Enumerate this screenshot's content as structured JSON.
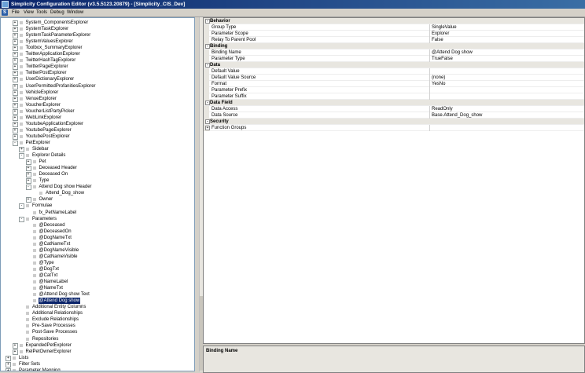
{
  "window": {
    "title": "Simplicity Configuration Editor (v3.5.5123.20879) - [Simplicity_CIS_Dev]"
  },
  "menu": [
    "File",
    "View",
    "Tools",
    "Debug",
    "Window"
  ],
  "tree": [
    {
      "label": "System_ComponentsExplorer",
      "level": 0,
      "exp": "+",
      "icon": "folder"
    },
    {
      "label": "SystemTaskExplorer",
      "level": 0,
      "exp": "+",
      "icon": "folder"
    },
    {
      "label": "SystemTaskParameterExplorer",
      "level": 0,
      "exp": "+",
      "icon": "folder"
    },
    {
      "label": "SystemValuesExplorer",
      "level": 0,
      "exp": "+",
      "icon": "folder"
    },
    {
      "label": "Toolbox_SummaryExplorer",
      "level": 0,
      "exp": "+",
      "icon": "folder"
    },
    {
      "label": "TwitterApplicationExplorer",
      "level": 0,
      "exp": "+",
      "icon": "folder"
    },
    {
      "label": "TwitterHashTagExplorer",
      "level": 0,
      "exp": "+",
      "icon": "folder"
    },
    {
      "label": "TwitterPageExplorer",
      "level": 0,
      "exp": "+",
      "icon": "folder"
    },
    {
      "label": "TwitterPostExplorer",
      "level": 0,
      "exp": "+",
      "icon": "folder"
    },
    {
      "label": "UserDictionaryExplorer",
      "level": 0,
      "exp": "+",
      "icon": "folder"
    },
    {
      "label": "UserPermittedProfanitiesExplorer",
      "level": 0,
      "exp": "+",
      "icon": "folder"
    },
    {
      "label": "VehicleExplorer",
      "level": 0,
      "exp": "+",
      "icon": "folder"
    },
    {
      "label": "VenueExplorer",
      "level": 0,
      "exp": "+",
      "icon": "folder"
    },
    {
      "label": "VoucherExplorer",
      "level": 0,
      "exp": "+",
      "icon": "folder"
    },
    {
      "label": "VoucherListPartyPicker",
      "level": 0,
      "exp": "+",
      "icon": "folder"
    },
    {
      "label": "WebLinkExplorer",
      "level": 0,
      "exp": "+",
      "icon": "folder"
    },
    {
      "label": "YoutubeApplicationExplorer",
      "level": 0,
      "exp": "+",
      "icon": "folder"
    },
    {
      "label": "YoutubePageExplorer",
      "level": 0,
      "exp": "+",
      "icon": "folder"
    },
    {
      "label": "YoutubePostExplorer",
      "level": 0,
      "exp": "+",
      "icon": "folder"
    },
    {
      "label": "PetExplorer",
      "level": 0,
      "exp": "-",
      "icon": "folder"
    },
    {
      "label": "Sidebar",
      "level": 1,
      "exp": "+",
      "icon": "folder"
    },
    {
      "label": "Explorer Details",
      "level": 1,
      "exp": "-",
      "icon": "folder"
    },
    {
      "label": "Pet",
      "level": 2,
      "exp": "+",
      "icon": "item"
    },
    {
      "label": "Deceased Header",
      "level": 2,
      "exp": "+",
      "icon": "item"
    },
    {
      "label": "Deceased On",
      "level": 2,
      "exp": "+",
      "icon": "item"
    },
    {
      "label": "Type",
      "level": 2,
      "exp": "+",
      "icon": "item"
    },
    {
      "label": "Attend Dog show Header",
      "level": 2,
      "exp": "-",
      "icon": "item"
    },
    {
      "label": "Attend_Dog_show",
      "level": 3,
      "exp": "",
      "icon": "item"
    },
    {
      "label": "Owner",
      "level": 2,
      "exp": "+",
      "icon": "item"
    },
    {
      "label": "Formulae",
      "level": 1,
      "exp": "-",
      "icon": "folder"
    },
    {
      "label": "fx_PetNameLabel",
      "level": 2,
      "exp": "",
      "icon": "item"
    },
    {
      "label": "Parameters",
      "level": 1,
      "exp": "-",
      "icon": "folder"
    },
    {
      "label": "@Deceased",
      "level": 2,
      "exp": "",
      "icon": "item"
    },
    {
      "label": "@DeceasedOn",
      "level": 2,
      "exp": "",
      "icon": "item"
    },
    {
      "label": "@DogNameTxt",
      "level": 2,
      "exp": "",
      "icon": "item"
    },
    {
      "label": "@CatNameTxt",
      "level": 2,
      "exp": "",
      "icon": "item"
    },
    {
      "label": "@DogNameVisible",
      "level": 2,
      "exp": "",
      "icon": "item"
    },
    {
      "label": "@CatNameVisible",
      "level": 2,
      "exp": "",
      "icon": "item"
    },
    {
      "label": "@Type",
      "level": 2,
      "exp": "",
      "icon": "item"
    },
    {
      "label": "@DogTxt",
      "level": 2,
      "exp": "",
      "icon": "item"
    },
    {
      "label": "@CatTxt",
      "level": 2,
      "exp": "",
      "icon": "item"
    },
    {
      "label": "@NameLabel",
      "level": 2,
      "exp": "",
      "icon": "item"
    },
    {
      "label": "@NameTxt",
      "level": 2,
      "exp": "",
      "icon": "item"
    },
    {
      "label": "@Attend Dog show Text",
      "level": 2,
      "exp": "",
      "icon": "item"
    },
    {
      "label": "@Attend Dog show",
      "level": 2,
      "exp": "",
      "icon": "item",
      "selected": true
    },
    {
      "label": "Additional Entity Columns",
      "level": 1,
      "exp": "",
      "icon": "item"
    },
    {
      "label": "Additional Relationships",
      "level": 1,
      "exp": "",
      "icon": "item"
    },
    {
      "label": "Exclude Relationships",
      "level": 1,
      "exp": "",
      "icon": "item"
    },
    {
      "label": "Pre-Save Processes",
      "level": 1,
      "exp": "",
      "icon": "item"
    },
    {
      "label": "Post-Save Processes",
      "level": 1,
      "exp": "",
      "icon": "item"
    },
    {
      "label": "Repositories",
      "level": 1,
      "exp": "",
      "icon": "item"
    },
    {
      "label": "ExpandedPetExplorer",
      "level": 0,
      "exp": "+",
      "icon": "folder"
    },
    {
      "label": "RelPetOwnerExplorer",
      "level": 0,
      "exp": "+",
      "icon": "folder"
    },
    {
      "label": "Lists",
      "level": -1,
      "exp": "+",
      "icon": "folder"
    },
    {
      "label": "Filter Sets",
      "level": -1,
      "exp": "+",
      "icon": "folder"
    },
    {
      "label": "Parameter Mapping",
      "level": -1,
      "exp": "+",
      "icon": "folder"
    }
  ],
  "properties": [
    {
      "category": "Behavior",
      "rows": [
        {
          "name": "Group Type",
          "value": "SingleValue"
        },
        {
          "name": "Parameter Scope",
          "value": "Explorer"
        },
        {
          "name": "Relay To Parent Pool",
          "value": "False"
        }
      ]
    },
    {
      "category": "Binding",
      "rows": [
        {
          "name": "Binding Name",
          "value": "@Attend Dog show"
        },
        {
          "name": "Parameter Type",
          "value": "TrueFalse"
        }
      ]
    },
    {
      "category": "Data",
      "rows": [
        {
          "name": "Default Value",
          "value": ""
        },
        {
          "name": "Default Value Source",
          "value": "(none)"
        },
        {
          "name": "Format",
          "value": "YesNo"
        },
        {
          "name": "Parameter Prefix",
          "value": ""
        },
        {
          "name": "Parameter Suffix",
          "value": ""
        }
      ]
    },
    {
      "category": "Data Field",
      "rows": [
        {
          "name": "Data Access",
          "value": "ReadOnly"
        },
        {
          "name": "Data Source",
          "value": "Base.Attend_Dog_show"
        }
      ]
    },
    {
      "category": "Security",
      "rows": [
        {
          "name": "Function Groups",
          "value": "",
          "expandable": true
        }
      ]
    }
  ],
  "help": {
    "title": "Binding Name"
  }
}
